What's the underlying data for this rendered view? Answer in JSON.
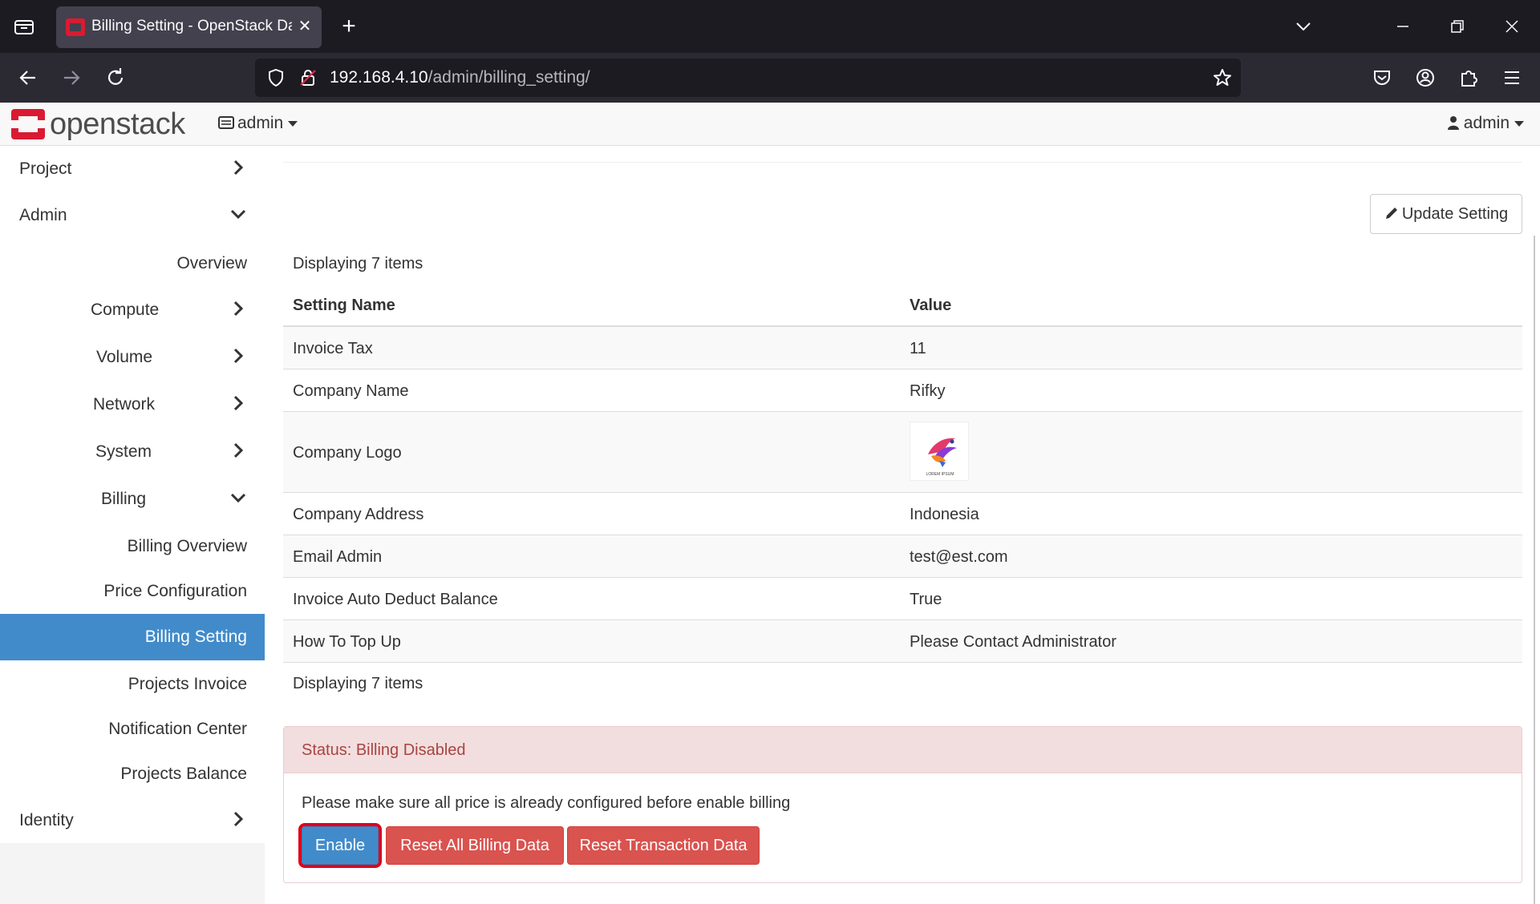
{
  "browser": {
    "tab_title": "Billing Setting - OpenStack Dash",
    "url_host": "192.168.4.10",
    "url_path": "/admin/billing_setting/"
  },
  "header": {
    "logo_text": "openstack",
    "project_label": "admin",
    "user_label": "admin"
  },
  "sidebar": {
    "items": [
      {
        "label": "Project"
      },
      {
        "label": "Admin"
      },
      {
        "label": "Overview"
      },
      {
        "label": "Compute"
      },
      {
        "label": "Volume"
      },
      {
        "label": "Network"
      },
      {
        "label": "System"
      },
      {
        "label": "Billing"
      },
      {
        "label": "Billing Overview"
      },
      {
        "label": "Price Configuration"
      },
      {
        "label": "Billing Setting"
      },
      {
        "label": "Projects Invoice"
      },
      {
        "label": "Notification Center"
      },
      {
        "label": "Projects Balance"
      },
      {
        "label": "Identity"
      }
    ]
  },
  "main": {
    "update_button": "Update Setting",
    "displaying_top": "Displaying 7 items",
    "displaying_bottom": "Displaying 7 items",
    "columns": [
      "Setting Name",
      "Value"
    ],
    "rows": [
      {
        "name": "Invoice Tax",
        "value": "11"
      },
      {
        "name": "Company Name",
        "value": "Rifky"
      },
      {
        "name": "Company Logo",
        "value": "LOREM IPSUM"
      },
      {
        "name": "Company Address",
        "value": "Indonesia"
      },
      {
        "name": "Email Admin",
        "value": "test@est.com"
      },
      {
        "name": "Invoice Auto Deduct Balance",
        "value": "True"
      },
      {
        "name": "How To Top Up",
        "value": "Please Contact Administrator"
      }
    ],
    "status": {
      "title": "Status: Billing Disabled",
      "message": "Please make sure all price is already configured before enable billing",
      "enable": "Enable",
      "reset_all": "Reset All Billing Data",
      "reset_transactions": "Reset Transaction Data"
    }
  },
  "colors": {
    "accent": "#428bca",
    "danger": "#d9534f",
    "alert_bg": "#f2dede",
    "highlight_outline": "#e0001a"
  }
}
